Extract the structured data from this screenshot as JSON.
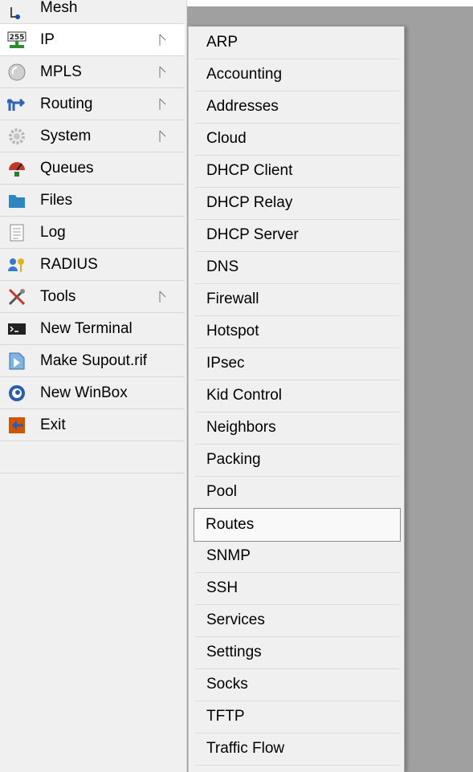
{
  "left_menu": {
    "items": [
      {
        "label": "Mesh",
        "icon": "mesh-icon",
        "has_submenu": false
      },
      {
        "label": "IP",
        "icon": "ip-icon",
        "has_submenu": true,
        "selected": true
      },
      {
        "label": "MPLS",
        "icon": "mpls-icon",
        "has_submenu": true
      },
      {
        "label": "Routing",
        "icon": "routing-icon",
        "has_submenu": true
      },
      {
        "label": "System",
        "icon": "system-gear-icon",
        "has_submenu": true
      },
      {
        "label": "Queues",
        "icon": "queues-icon",
        "has_submenu": false
      },
      {
        "label": "Files",
        "icon": "folder-icon",
        "has_submenu": false
      },
      {
        "label": "Log",
        "icon": "log-icon",
        "has_submenu": false
      },
      {
        "label": "RADIUS",
        "icon": "radius-icon",
        "has_submenu": false
      },
      {
        "label": "Tools",
        "icon": "tools-icon",
        "has_submenu": true
      },
      {
        "label": "New Terminal",
        "icon": "terminal-icon",
        "has_submenu": false
      },
      {
        "label": "Make Supout.rif",
        "icon": "supout-icon",
        "has_submenu": false
      },
      {
        "label": "New WinBox",
        "icon": "winbox-icon",
        "has_submenu": false
      },
      {
        "label": "Exit",
        "icon": "exit-icon",
        "has_submenu": false
      }
    ]
  },
  "ip_submenu": {
    "items": [
      "ARP",
      "Accounting",
      "Addresses",
      "Cloud",
      "DHCP Client",
      "DHCP Relay",
      "DHCP Server",
      "DNS",
      "Firewall",
      "Hotspot",
      "IPsec",
      "Kid Control",
      "Neighbors",
      "Packing",
      "Pool",
      "Routes",
      "SNMP",
      "SSH",
      "Services",
      "Settings",
      "Socks",
      "TFTP",
      "Traffic Flow"
    ],
    "highlighted": "Routes"
  },
  "colors": {
    "menu_bg": "#f0f0f0",
    "desktop_bg": "#a0a0a0",
    "separator": "#d8d8d8",
    "highlight_border": "#8e8e8e"
  }
}
